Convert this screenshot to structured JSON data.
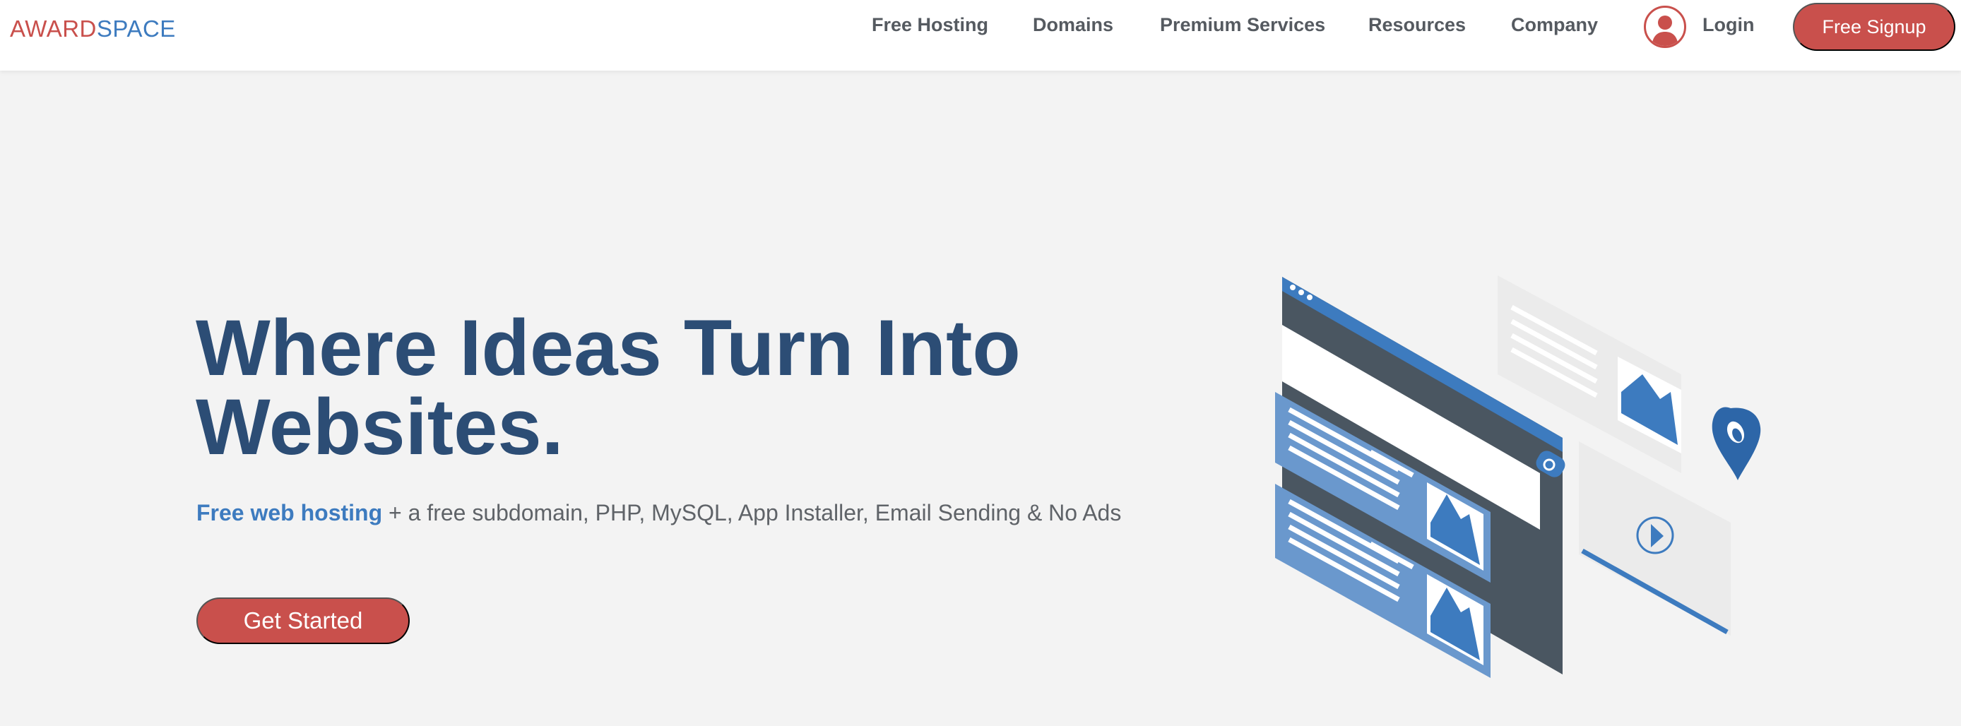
{
  "header": {
    "logo": {
      "part1": "AWARD",
      "part2": "SPACE"
    },
    "nav": [
      {
        "label": "Free Hosting"
      },
      {
        "label": "Domains"
      },
      {
        "label": "Premium Services"
      },
      {
        "label": "Resources"
      },
      {
        "label": "Company"
      }
    ],
    "login_label": "Login",
    "signup_label": "Free Signup"
  },
  "hero": {
    "title_line1": "Where Ideas Turn Into",
    "title_line2": "Websites.",
    "subtitle_highlight": "Free web hosting",
    "subtitle_rest": " + a free subdomain, PHP, MySQL, App Installer, Email Sending & No Ads",
    "cta_label": "Get Started"
  },
  "colors": {
    "brand_red": "#c9504c",
    "brand_blue": "#3d7bbf",
    "title_navy": "#2c4d75",
    "background": "#f3f3f3"
  },
  "icons": {
    "avatar": "user-avatar-icon",
    "illustration": "website-builder-illustration"
  }
}
